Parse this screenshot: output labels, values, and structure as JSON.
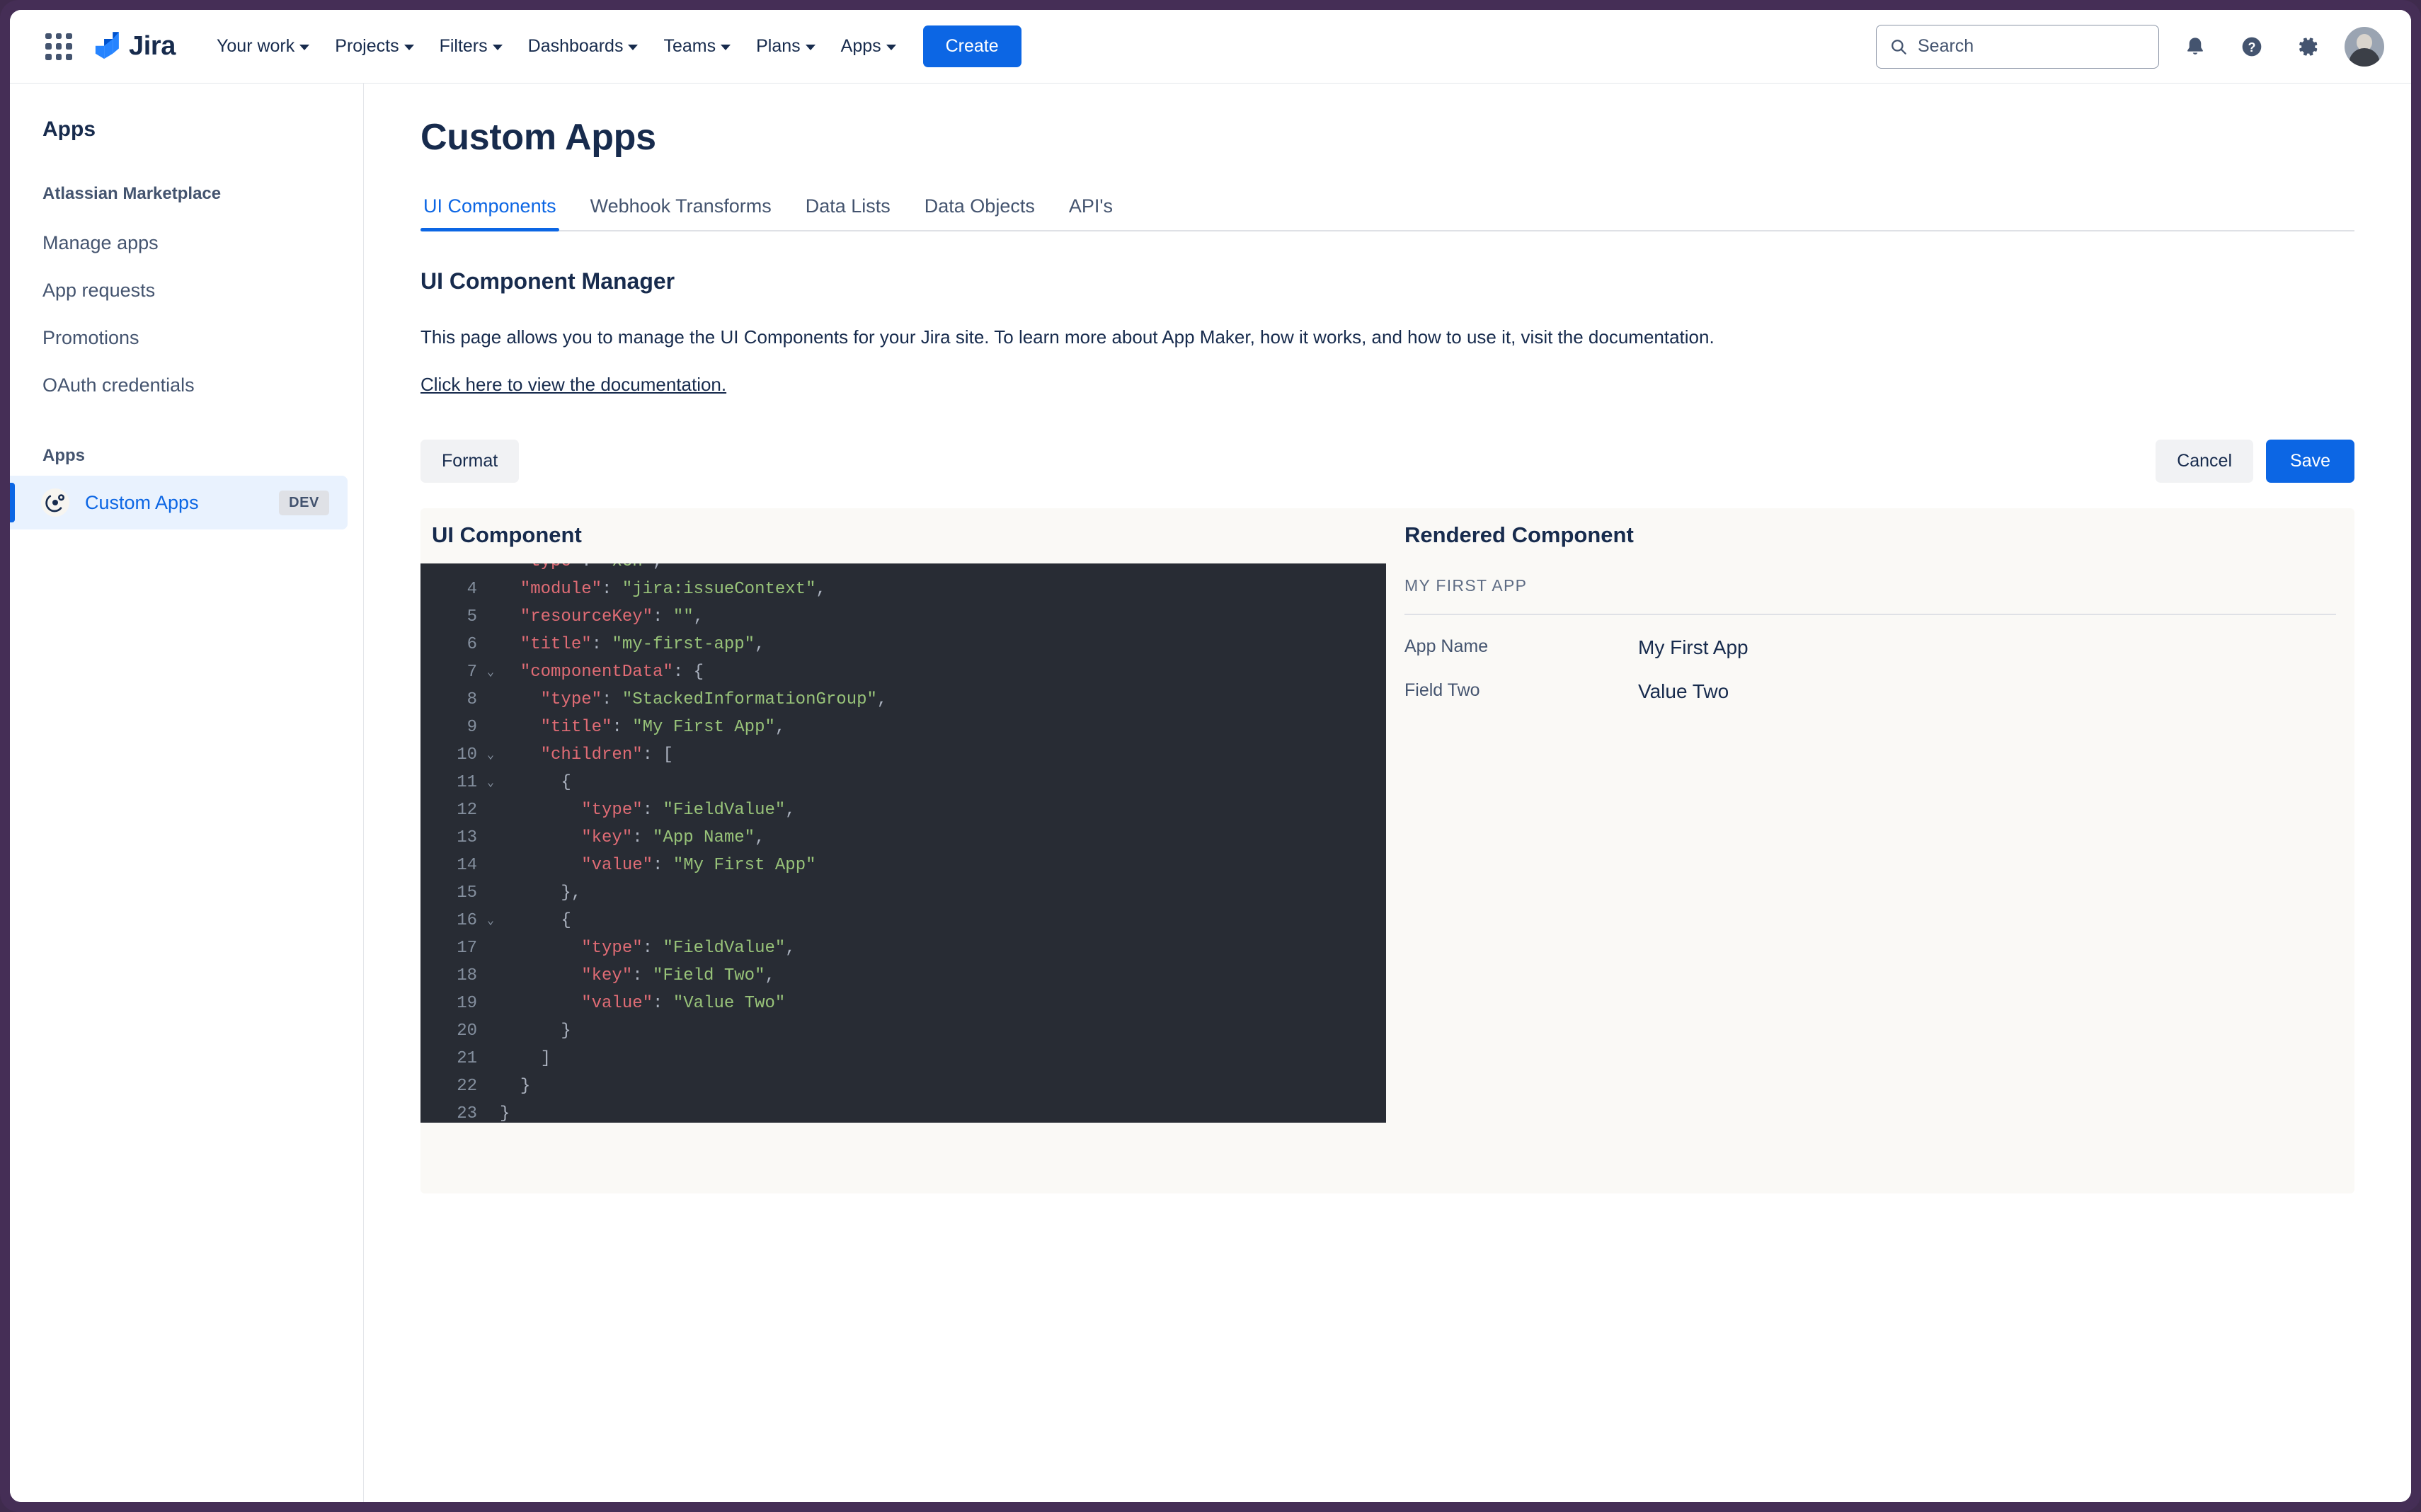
{
  "window": {
    "frame_color": "#452e56"
  },
  "topnav": {
    "app_switcher_icon": "grid-apps-icon",
    "brand": "Jira",
    "items": [
      {
        "label": "Your work",
        "has_caret": true
      },
      {
        "label": "Projects",
        "has_caret": true
      },
      {
        "label": "Filters",
        "has_caret": true
      },
      {
        "label": "Dashboards",
        "has_caret": true
      },
      {
        "label": "Teams",
        "has_caret": true
      },
      {
        "label": "Plans",
        "has_caret": true
      },
      {
        "label": "Apps",
        "has_caret": true
      }
    ],
    "create_label": "Create",
    "search_placeholder": "Search",
    "icons": [
      "notifications-bell-icon",
      "help-question-icon",
      "settings-gear-icon",
      "user-avatar"
    ],
    "accent_color": "#0c66e4"
  },
  "sidebar": {
    "title": "Apps",
    "group_one": "Atlassian Marketplace",
    "links": [
      {
        "label": "Manage apps"
      },
      {
        "label": "App requests"
      },
      {
        "label": "Promotions"
      },
      {
        "label": "OAuth credentials"
      }
    ],
    "group_two": "Apps",
    "active_item": {
      "label": "Custom Apps",
      "badge": "DEV",
      "icon": "orbit-app-icon"
    }
  },
  "main": {
    "page_title": "Custom Apps",
    "tabs": [
      {
        "label": "UI Components",
        "active": true
      },
      {
        "label": "Webhook Transforms",
        "active": false
      },
      {
        "label": "Data Lists",
        "active": false
      },
      {
        "label": "Data Objects",
        "active": false
      },
      {
        "label": "API's",
        "active": false
      }
    ],
    "section_heading": "UI Component Manager",
    "section_paragraph": "This page allows you to manage the UI Components for your Jira site. To learn more about App Maker, how it works, and how to use it, visit the documentation.",
    "doc_link": "Click here to view the documentation.",
    "buttons": {
      "format": "Format",
      "cancel": "Cancel",
      "save": "Save"
    }
  },
  "editor": {
    "heading": "UI Component",
    "background": "#282c34",
    "lines": [
      {
        "num": "4",
        "fold": "",
        "indent": 2,
        "key": "\"module\"",
        "sep": ": ",
        "val": "\"jira:issueContext\"",
        "tail": ","
      },
      {
        "num": "5",
        "fold": "",
        "indent": 2,
        "key": "\"resourceKey\"",
        "sep": ": ",
        "val": "\"\"",
        "tail": ","
      },
      {
        "num": "6",
        "fold": "",
        "indent": 2,
        "key": "\"title\"",
        "sep": ": ",
        "val": "\"my-first-app\"",
        "tail": ","
      },
      {
        "num": "7",
        "fold": "v",
        "indent": 2,
        "key": "\"componentData\"",
        "sep": ": ",
        "val": "",
        "tail": "{"
      },
      {
        "num": "8",
        "fold": "",
        "indent": 4,
        "key": "\"type\"",
        "sep": ": ",
        "val": "\"StackedInformationGroup\"",
        "tail": ","
      },
      {
        "num": "9",
        "fold": "",
        "indent": 4,
        "key": "\"title\"",
        "sep": ": ",
        "val": "\"My First App\"",
        "tail": ","
      },
      {
        "num": "10",
        "fold": "v",
        "indent": 4,
        "key": "\"children\"",
        "sep": ": ",
        "val": "",
        "tail": "["
      },
      {
        "num": "11",
        "fold": "v",
        "indent": 6,
        "key": "",
        "sep": "",
        "val": "",
        "tail": "{"
      },
      {
        "num": "12",
        "fold": "",
        "indent": 8,
        "key": "\"type\"",
        "sep": ": ",
        "val": "\"FieldValue\"",
        "tail": ","
      },
      {
        "num": "13",
        "fold": "",
        "indent": 8,
        "key": "\"key\"",
        "sep": ": ",
        "val": "\"App Name\"",
        "tail": ","
      },
      {
        "num": "14",
        "fold": "",
        "indent": 8,
        "key": "\"value\"",
        "sep": ": ",
        "val": "\"My First App\"",
        "tail": ""
      },
      {
        "num": "15",
        "fold": "",
        "indent": 6,
        "key": "",
        "sep": "",
        "val": "",
        "tail": "},"
      },
      {
        "num": "16",
        "fold": "v",
        "indent": 6,
        "key": "",
        "sep": "",
        "val": "",
        "tail": "{"
      },
      {
        "num": "17",
        "fold": "",
        "indent": 8,
        "key": "\"type\"",
        "sep": ": ",
        "val": "\"FieldValue\"",
        "tail": ","
      },
      {
        "num": "18",
        "fold": "",
        "indent": 8,
        "key": "\"key\"",
        "sep": ": ",
        "val": "\"Field Two\"",
        "tail": ","
      },
      {
        "num": "19",
        "fold": "",
        "indent": 8,
        "key": "\"value\"",
        "sep": ": ",
        "val": "\"Value Two\"",
        "tail": ""
      },
      {
        "num": "20",
        "fold": "",
        "indent": 6,
        "key": "",
        "sep": "",
        "val": "",
        "tail": "}"
      },
      {
        "num": "21",
        "fold": "",
        "indent": 4,
        "key": "",
        "sep": "",
        "val": "",
        "tail": "]"
      },
      {
        "num": "22",
        "fold": "",
        "indent": 2,
        "key": "",
        "sep": "",
        "val": "",
        "tail": "}"
      },
      {
        "num": "23",
        "fold": "",
        "indent": 0,
        "key": "",
        "sep": "",
        "val": "",
        "tail": "}"
      }
    ]
  },
  "rendered": {
    "heading": "Rendered Component",
    "group_title": "MY FIRST APP",
    "rows": [
      {
        "key": "App Name",
        "value": "My First App"
      },
      {
        "key": "Field Two",
        "value": "Value Two"
      }
    ]
  }
}
